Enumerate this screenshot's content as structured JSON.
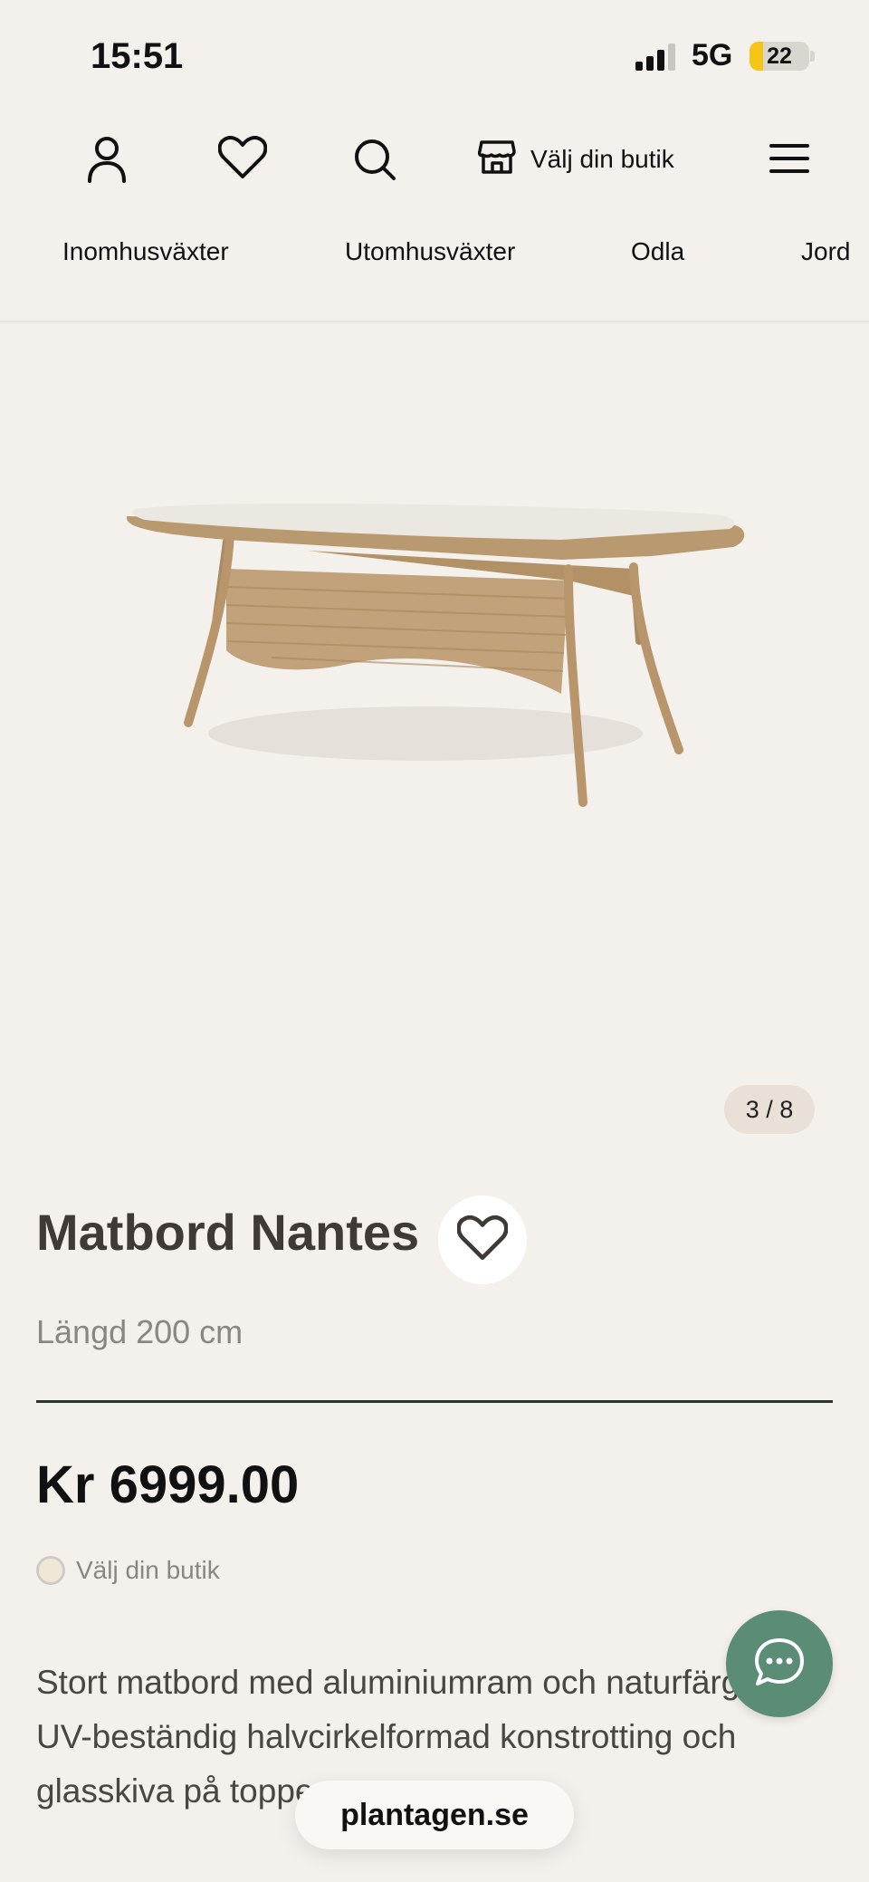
{
  "status_bar": {
    "time": "15:51",
    "network": "5G",
    "battery": "22",
    "battery_level": 0.22,
    "battery_color": "#f5c518"
  },
  "header": {
    "icons": [
      "account-icon",
      "heart-icon",
      "search-icon",
      "store-icon",
      "menu-icon"
    ],
    "store_label": "Välj din butik"
  },
  "category_nav": {
    "items": [
      "Inomhusväxter",
      "Utomhusväxter",
      "Odla",
      "Jord"
    ]
  },
  "gallery": {
    "counter": "3 / 8",
    "current": 3,
    "total": 8
  },
  "product": {
    "title": "Matbord Nantes",
    "subtitle": "Längd 200 cm",
    "price": "Kr 6999.00",
    "store_status": "Välj din butik",
    "description": "Stort matbord med aluminiumram och naturfärgad UV-beständig halvcirkelformad konstrotting och glasskiva på toppen."
  },
  "chat": {
    "icon": "chat-icon",
    "color": "#5a8c76"
  },
  "browser": {
    "domain": "plantagen.se"
  },
  "colors": {
    "background": "#f4f1ec",
    "divider": "#26382b",
    "counter_bg": "#e9e1d7"
  }
}
